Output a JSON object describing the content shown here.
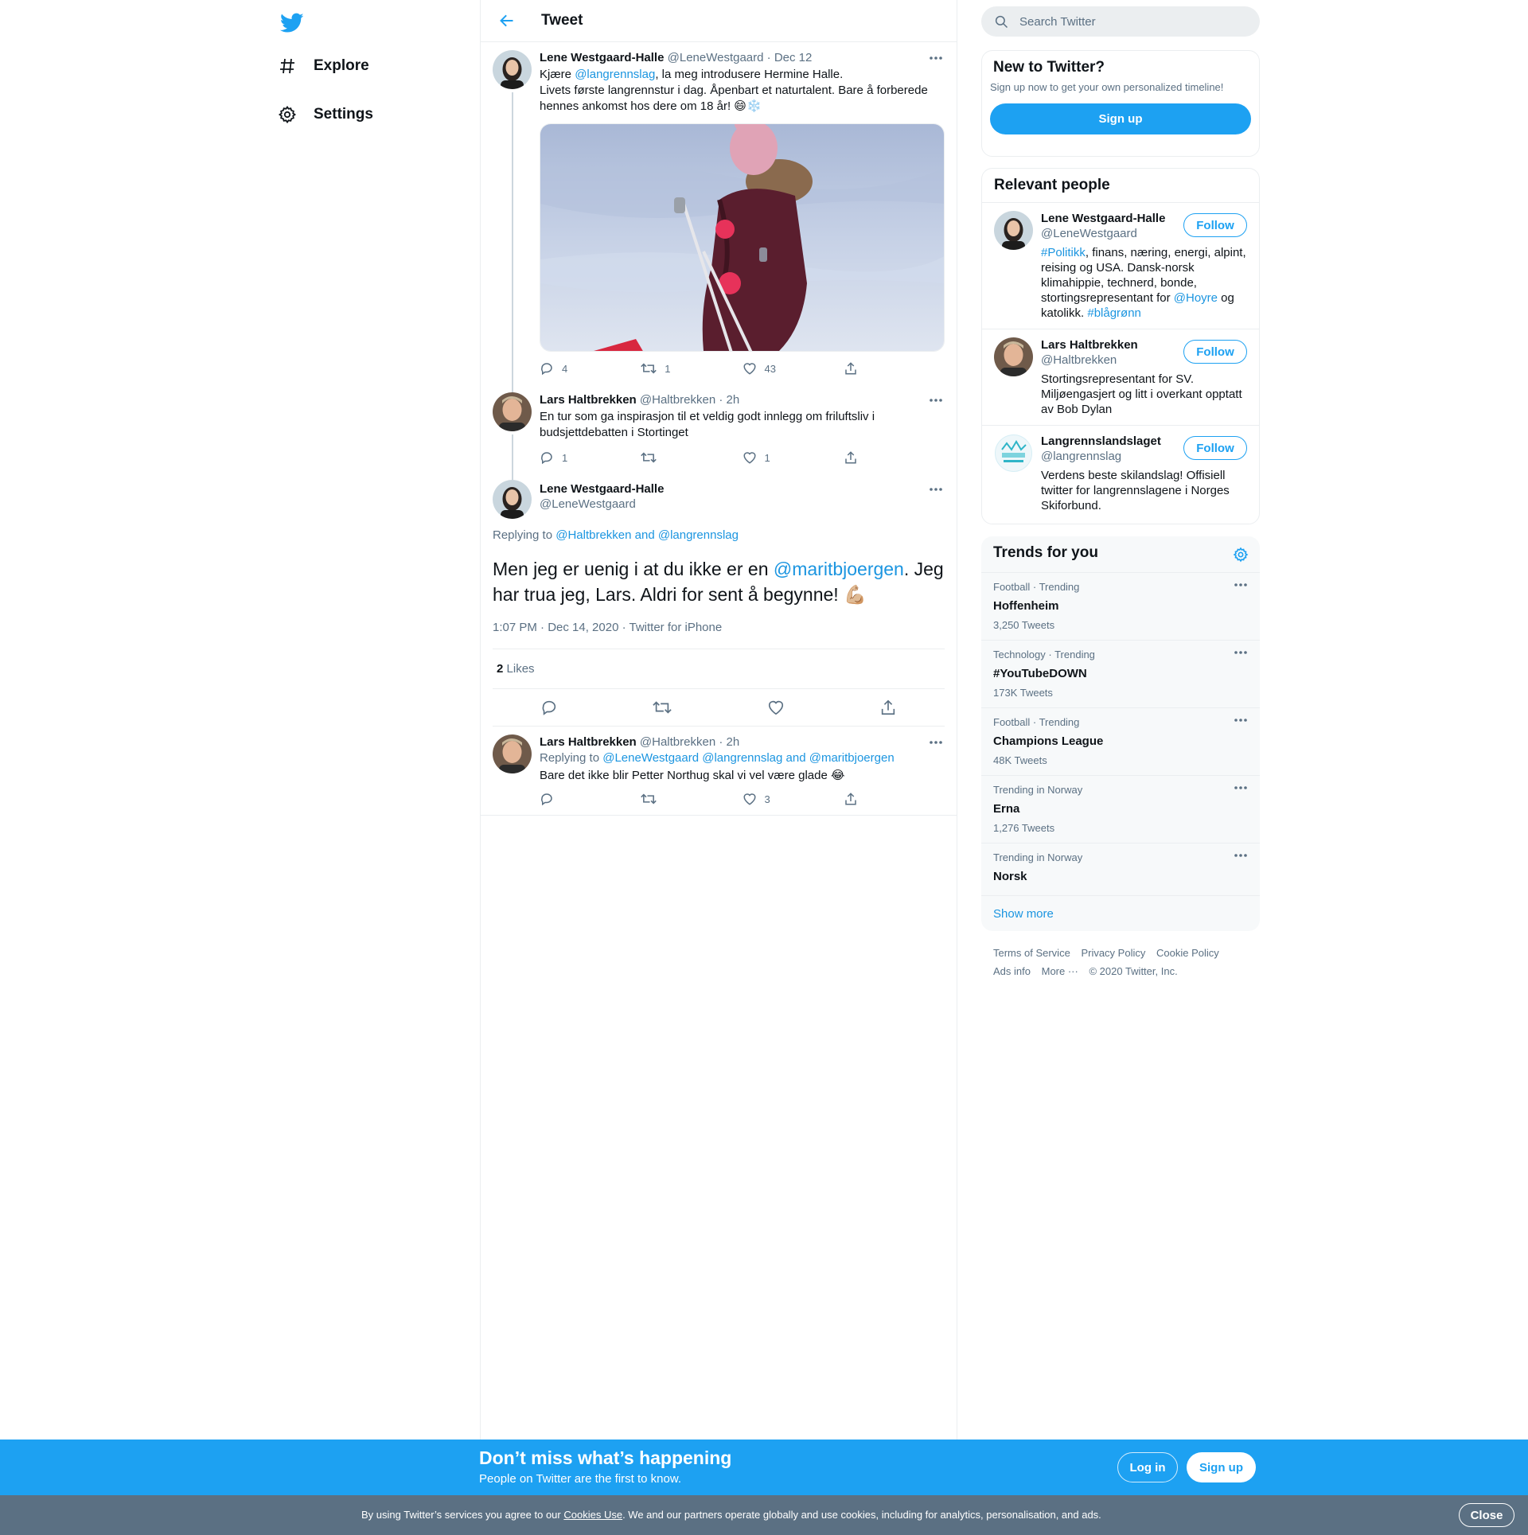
{
  "nav": {
    "items": [
      {
        "label": "Explore",
        "icon": "hashtag-icon"
      },
      {
        "label": "Settings",
        "icon": "gear-icon"
      }
    ]
  },
  "header": {
    "title": "Tweet"
  },
  "thread": [
    {
      "name": "Lene Westgaard-Halle",
      "handle": "@LeneWestgaard",
      "sep": "·",
      "time": "Dec 12",
      "text_line1_pre": "Kjære ",
      "text_line1_mention": "@langrennslag",
      "text_line1_post": ", la meg introdusere Hermine Halle.",
      "text_line2": "Livets første langrennstur i dag. Åpenbart et naturtalent. Bare å forberede hennes ankomst hos dere om 18 år! 😄❄️",
      "replies": "4",
      "retweets": "1",
      "likes": "43"
    },
    {
      "name": "Lars Haltbrekken",
      "handle": "@Haltbrekken",
      "sep": "·",
      "time": "2h",
      "text": "En tur som ga inspirasjon til et veldig godt innlegg om friluftsliv i budsjettdebatten i Stortinget",
      "replies": "1",
      "retweets": "",
      "likes": "1"
    }
  ],
  "main_tweet": {
    "name": "Lene Westgaard-Halle",
    "handle": "@LeneWestgaard",
    "replying_label": "Replying to",
    "replying_to": "@Haltbrekken and @langrennslag",
    "text_pre": "Men jeg er uenig i at du ikke er en ",
    "mention": "@maritbjoergen",
    "text_post": ". Jeg har trua jeg, Lars. Aldri for sent å begynne! 💪🏼",
    "meta": "1:07 PM · Dec 14, 2020 · Twitter for iPhone",
    "likes_count": "2",
    "likes_label": "Likes"
  },
  "reply": {
    "name": "Lars Haltbrekken",
    "handle": "@Haltbrekken",
    "sep": "·",
    "time": "2h",
    "replying_label": "Replying to",
    "replying_to": "@LeneWestgaard @langrennslag and @maritbjoergen",
    "text": "Bare det ikke blir Petter Northug skal vi vel være glade 😂",
    "replies": "",
    "retweets": "",
    "likes": "3"
  },
  "search": {
    "placeholder": "Search Twitter"
  },
  "new_to_twitter": {
    "title": "New to Twitter?",
    "subtitle": "Sign up now to get your own personalized timeline!",
    "button": "Sign up"
  },
  "relevant_people": {
    "title": "Relevant people",
    "follow_label": "Follow",
    "people": [
      {
        "name": "Lene Westgaard-Halle",
        "handle": "@LeneWestgaard",
        "bio_tag1": "#Politikk",
        "bio_mid": ", finans, næring, energi, alpint, reising og USA. Dansk-norsk klimahippie, technerd, bonde, stortingsrepresentant for ",
        "bio_mention": "@Hoyre",
        "bio_mid2": " og katolikk. ",
        "bio_tag2": "#blågrønn"
      },
      {
        "name": "Lars Haltbrekken",
        "handle": "@Haltbrekken",
        "bio": "Stortingsrepresentant for SV. Miljøengasjert og litt i overkant opptatt av Bob Dylan"
      },
      {
        "name": "Langrennslandslaget",
        "handle": "@langrennslag",
        "bio": "Verdens beste skilandslag! Offisiell twitter for langrennslagene i Norges Skiforbund."
      }
    ]
  },
  "trends": {
    "title": "Trends for you",
    "items": [
      {
        "meta": "Football · Trending",
        "name": "Hoffenheim",
        "count": "3,250 Tweets"
      },
      {
        "meta": "Technology · Trending",
        "name": "#YouTubeDOWN",
        "count": "173K Tweets"
      },
      {
        "meta": "Football · Trending",
        "name": "Champions League",
        "count": "48K Tweets"
      },
      {
        "meta": "Trending in Norway",
        "name": "Erna",
        "count": "1,276 Tweets"
      },
      {
        "meta": "Trending in Norway",
        "name": "Norsk",
        "count": ""
      }
    ],
    "show_more": "Show more"
  },
  "footer": {
    "links": [
      "Terms of Service",
      "Privacy Policy",
      "Cookie Policy",
      "Ads info",
      "More ···"
    ],
    "copyright": "© 2020 Twitter, Inc."
  },
  "bottom_bar": {
    "title": "Don’t miss what’s happening",
    "subtitle": "People on Twitter are the first to know.",
    "login": "Log in",
    "signup": "Sign up"
  },
  "cookie": {
    "pre": "By using Twitter’s services you agree to our ",
    "link": "Cookies Use",
    "post": ". We and our partners operate globally and use cookies, including for analytics, personalisation, and ads.",
    "close": "Close"
  },
  "colors": {
    "accent": "#1da1f2",
    "link": "#1b95e0",
    "secondary_text": "#5b7083",
    "border": "#ebeef0",
    "cookie_bar": "#5b7083"
  }
}
